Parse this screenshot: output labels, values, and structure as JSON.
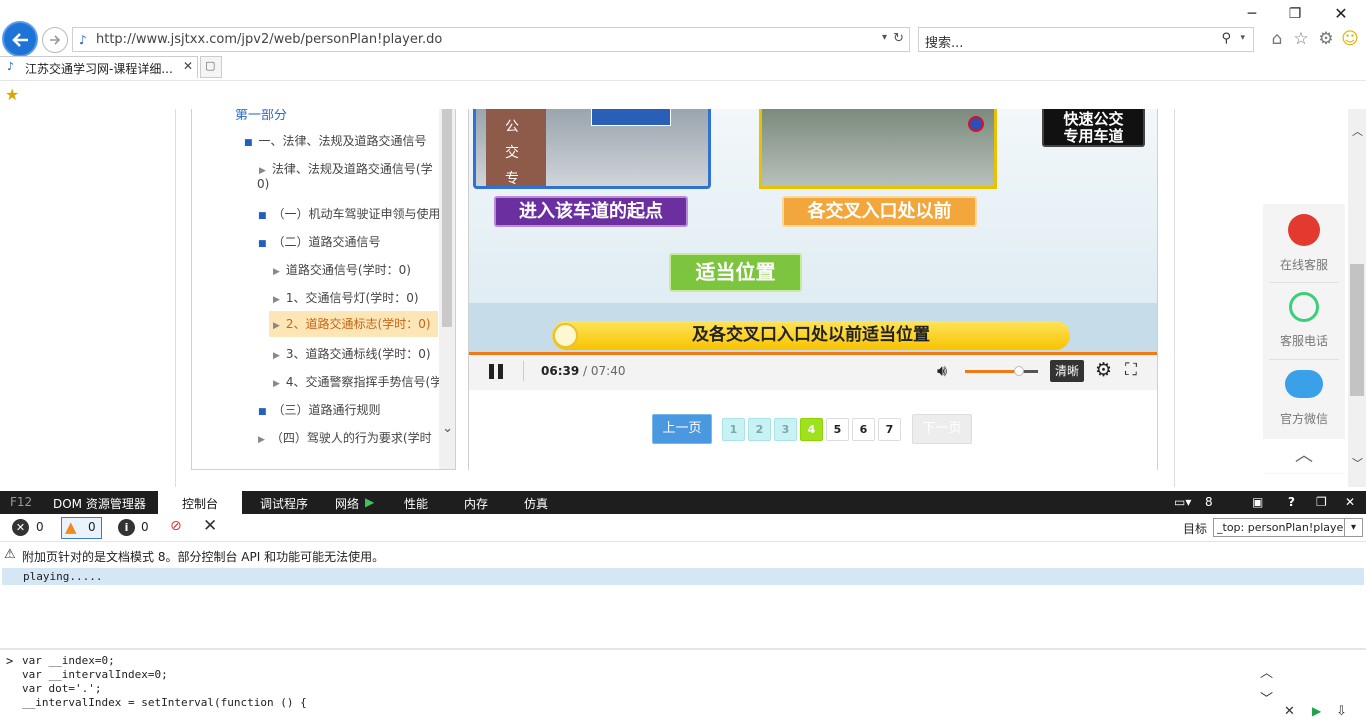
{
  "browser": {
    "url": "http://www.jsjtxx.com/jpv2/web/personPlan!player.do",
    "search_placeholder": "搜索...",
    "tab_title": "江苏交通学习网-课程详细...",
    "window_controls": [
      "minimize-icon",
      "restore-icon",
      "close-icon"
    ],
    "toolbar_icons": [
      "home-icon",
      "favorites-star-icon",
      "settings-gear-icon",
      "smiley-feedback-icon"
    ]
  },
  "tree": {
    "part": "第一部分",
    "items": [
      {
        "kind": "bullet",
        "label": "一、法律、法规及道路交通信号"
      },
      {
        "kind": "tri",
        "label": "法律、法规及道路交通信号(学"
      },
      {
        "kind": "cont",
        "label": "0)"
      },
      {
        "kind": "bullet",
        "label": "（一）机动车驾驶证申领与使用"
      },
      {
        "kind": "bullet",
        "label": "（二）道路交通信号"
      },
      {
        "kind": "tri",
        "label": "道路交通信号(学时：0)"
      },
      {
        "kind": "tri",
        "label": "1、交通信号灯(学时：0)"
      },
      {
        "kind": "tri",
        "label": "2、道路交通标志(学时：0)",
        "selected": true
      },
      {
        "kind": "tri",
        "label": "3、道路交通标线(学时：0)"
      },
      {
        "kind": "tri",
        "label": "4、交通警察指挥手势信号(学"
      },
      {
        "kind": "bullet",
        "label": "（三）道路通行规则"
      },
      {
        "kind": "tri",
        "label": "（四）驾驶人的行为要求(学时"
      }
    ]
  },
  "video": {
    "sign_right": "快速公交\n专用车道",
    "caption_purple": "进入该车道的起点",
    "caption_orange": "各交叉入口处以前",
    "caption_green": "适当位置",
    "subtitle": "及各交叉口入口处以前适当位置",
    "road_text": "公 交 专"
  },
  "controls": {
    "current_time": "06:39",
    "separator": " / ",
    "total_time": "07:40",
    "quality": "清晰",
    "volume_level": 0.74,
    "progress": 0.867
  },
  "pager": {
    "prev": "上一页",
    "next": "下一页",
    "pages": [
      "1",
      "2",
      "3",
      "4",
      "5",
      "6",
      "7"
    ],
    "current": "4"
  },
  "service": {
    "online": "在线客服",
    "phone": "客服电话",
    "wechat": "官方微信"
  },
  "devtools": {
    "tabs": [
      "F12",
      "DOM 资源管理器",
      "控制台",
      "调试程序",
      "网络",
      "性能",
      "内存",
      "仿真"
    ],
    "active_tab": "控制台",
    "errors": "0",
    "warnings": "0",
    "infos": "0",
    "doc_mode": "8",
    "target_label": "目标",
    "target_value": "_top: personPlan!player.",
    "warning_message": "附加页针对的是文档模式 8。部分控制台 API 和功能可能无法使用。",
    "log_line": "playing.....",
    "input_lines": [
      "var __index=0;",
      "var __intervalIndex=0;",
      "var dot='.';",
      "__intervalIndex = setInterval(function () {"
    ]
  }
}
